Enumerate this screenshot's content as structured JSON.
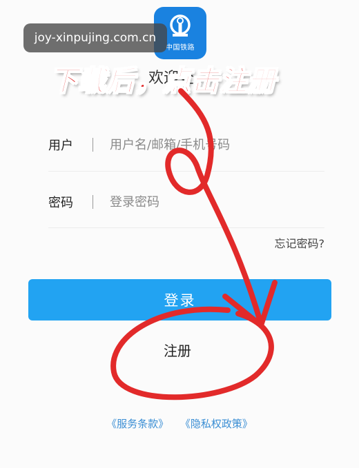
{
  "watermark": {
    "text": "joy-xinpujing.com.cn"
  },
  "logo": {
    "caption": "中国铁路"
  },
  "welcome": {
    "visible_text": "欢迎登"
  },
  "banner": {
    "text": "下载后，点击注册"
  },
  "form": {
    "user": {
      "label": "用户",
      "placeholder": "用户名/邮箱/手机号码"
    },
    "password": {
      "label": "密码",
      "placeholder": "登录密码"
    },
    "forgot_label": "忘记密码?"
  },
  "actions": {
    "login_label": "登录",
    "register_label": "注册"
  },
  "terms": {
    "service": "《服务条款》",
    "privacy": "《隐私权政策》"
  },
  "colors": {
    "primary": "#22a3f2",
    "logo_bg": "#1a82e0",
    "annotation_red": "#e22a2a",
    "link_blue": "#3a8ed4"
  }
}
